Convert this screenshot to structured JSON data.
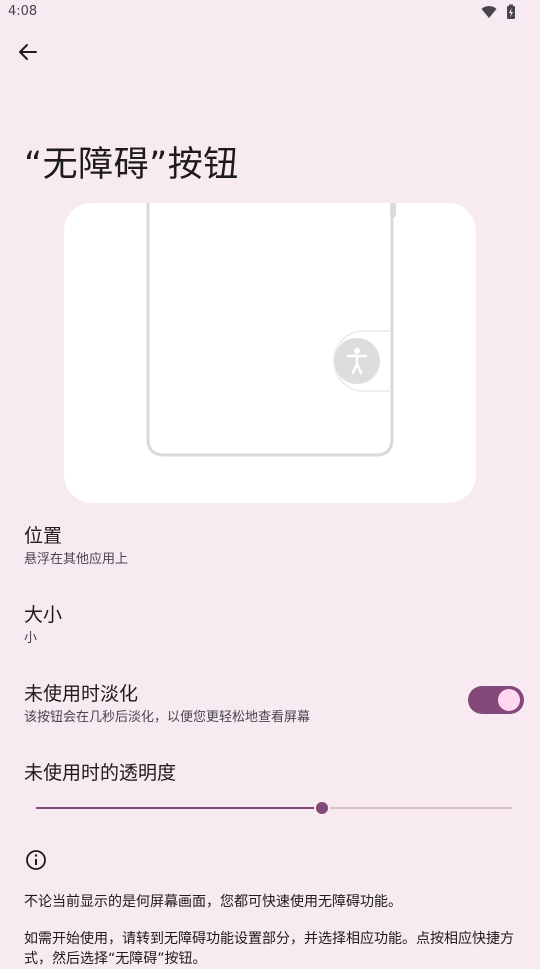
{
  "status_bar": {
    "time": "4:08",
    "icons": [
      "wifi-icon",
      "battery-charging-icon"
    ]
  },
  "header": {
    "back_icon": "arrow-left-icon",
    "title": "“无障碍”按钮"
  },
  "preview": {
    "illustration": "phone-outline-with-floating-accessibility-button",
    "floating_button_icon": "accessibility-person-icon"
  },
  "settings": {
    "location": {
      "title": "位置",
      "summary": "悬浮在其他应用上"
    },
    "size": {
      "title": "大小",
      "summary": "小"
    },
    "fade": {
      "title": "未使用时淡化",
      "summary": "该按钮会在几秒后淡化，以便您更轻松地查看屏幕",
      "enabled": true
    },
    "transparency": {
      "title": "未使用时的透明度",
      "value": 0.6
    }
  },
  "footer": {
    "info_icon": "info-circle-icon",
    "paragraph1": "不论当前显示的是何屏幕画面，您都可快速使用无障碍功能。",
    "paragraph2": "如需开始使用，请转到无障碍功能设置部分，并选择相应功能。点按相应快捷方式，然后选择“无障碍”按钮。"
  },
  "colors": {
    "background": "#f7eaf0",
    "accent": "#84487a",
    "toggle_thumb": "#ffd7f3",
    "card": "#ffffff"
  }
}
